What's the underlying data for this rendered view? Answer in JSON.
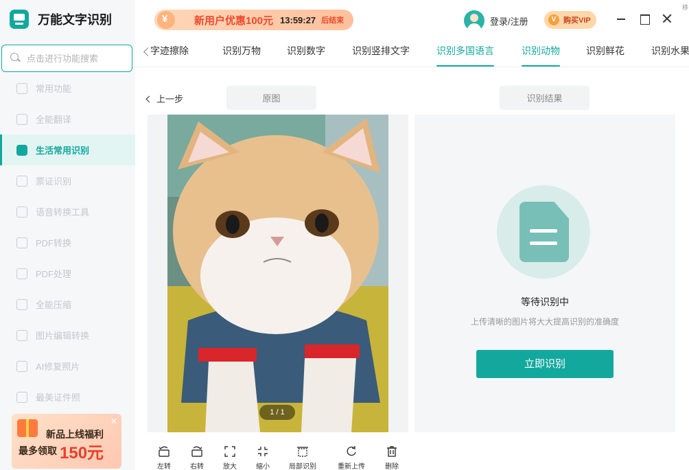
{
  "app": {
    "title": "万能文字识别"
  },
  "search": {
    "placeholder": "点击进行功能搜索"
  },
  "sidebar": {
    "items": [
      {
        "label": "常用功能",
        "icon": "scan-frame-icon"
      },
      {
        "label": "全能翻译",
        "icon": "translate-icon"
      },
      {
        "label": "生活常用识别",
        "icon": "robot-icon",
        "active": true
      },
      {
        "label": "票证识别",
        "icon": "ticket-icon"
      },
      {
        "label": "语音转换工具",
        "icon": "voice-icon"
      },
      {
        "label": "PDF转换",
        "icon": "pdf-convert-icon"
      },
      {
        "label": "PDF处理",
        "icon": "pdf-process-icon"
      },
      {
        "label": "全能压缩",
        "icon": "compress-icon"
      },
      {
        "label": "图片编辑转换",
        "icon": "image-edit-icon"
      },
      {
        "label": "AI修复照片",
        "icon": "ai-repair-icon"
      },
      {
        "label": "最美证件照",
        "icon": "id-photo-icon"
      }
    ],
    "promo": {
      "line1": "新品上线福利",
      "line2": "最多领取",
      "amount": "150元"
    }
  },
  "topbar": {
    "banner_text": "新用户优惠100元",
    "countdown": "13:59:27",
    "banner_end": "后结束",
    "login": "登录/注册",
    "vip": "购买VIP",
    "edge_text": "移"
  },
  "tabs": [
    {
      "label": "字迹擦除"
    },
    {
      "label": "识别万物"
    },
    {
      "label": "识别数字"
    },
    {
      "label": "识别竖排文字"
    },
    {
      "label": "识别多国语言"
    },
    {
      "label": "识别动物",
      "active": true
    },
    {
      "label": "识别鲜花"
    },
    {
      "label": "识别水果"
    }
  ],
  "main": {
    "back": "上一步",
    "original_label": "原图",
    "result_label": "识别结果",
    "page_indicator": "1 / 1",
    "wait_title": "等待识别中",
    "wait_sub": "上传清晰的图片将大大提高识别的准确度",
    "recognize_button": "立即识别"
  },
  "toolbar": [
    {
      "label": "左转",
      "icon": "rotate-left-icon"
    },
    {
      "label": "右转",
      "icon": "rotate-right-icon"
    },
    {
      "label": "放大",
      "icon": "zoom-in-icon"
    },
    {
      "label": "缩小",
      "icon": "zoom-out-icon"
    },
    {
      "label": "局部识别",
      "icon": "crop-icon"
    },
    {
      "label": "重新上传",
      "icon": "reupload-icon"
    },
    {
      "label": "删除",
      "icon": "delete-icon"
    }
  ],
  "colors": {
    "accent": "#13a89e",
    "promo_red": "#e8402a",
    "banner_red": "#ec4a2c"
  }
}
